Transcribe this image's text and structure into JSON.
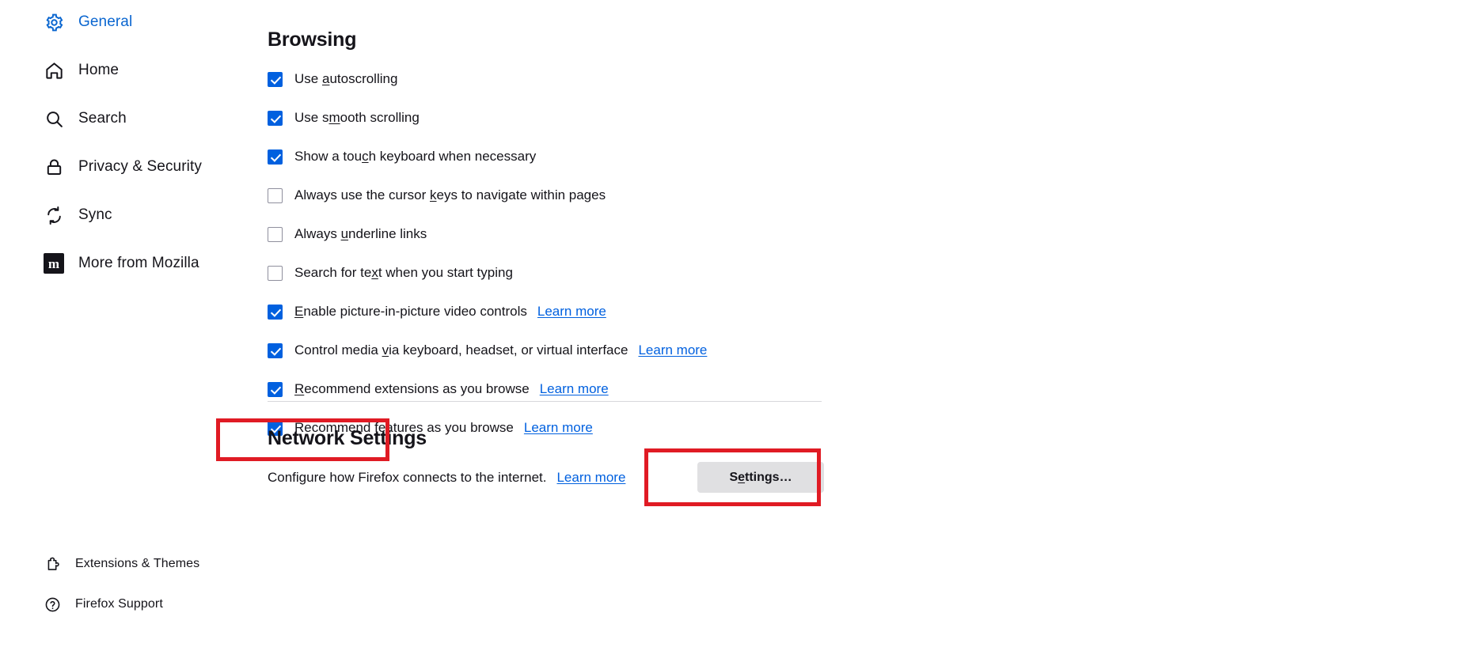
{
  "sidebar": {
    "items": [
      {
        "id": "general",
        "label": "General",
        "icon": "gear-icon",
        "active": true
      },
      {
        "id": "home",
        "label": "Home",
        "icon": "home-icon",
        "active": false
      },
      {
        "id": "search",
        "label": "Search",
        "icon": "search-icon",
        "active": false
      },
      {
        "id": "privacy",
        "label": "Privacy & Security",
        "icon": "lock-icon",
        "active": false
      },
      {
        "id": "sync",
        "label": "Sync",
        "icon": "sync-icon",
        "active": false
      },
      {
        "id": "mozilla",
        "label": "More from Mozilla",
        "icon": "mozilla-m-icon",
        "active": false,
        "badge_letter": "m"
      }
    ],
    "bottom_items": [
      {
        "id": "extensions",
        "label": "Extensions & Themes",
        "icon": "puzzle-piece-icon"
      },
      {
        "id": "support",
        "label": "Firefox Support",
        "icon": "question-circle-icon"
      }
    ]
  },
  "browsing": {
    "title": "Browsing",
    "options": [
      {
        "id": "autoscrolling",
        "checked": true,
        "pre": "Use ",
        "key": "a",
        "post": "utoscrolling",
        "learn_more": null
      },
      {
        "id": "smooth-scrolling",
        "checked": true,
        "pre": "Use s",
        "key": "m",
        "post": "ooth scrolling",
        "learn_more": null
      },
      {
        "id": "touch-keyboard",
        "checked": true,
        "pre": "Show a tou",
        "key": "c",
        "post": "h keyboard when necessary",
        "learn_more": null
      },
      {
        "id": "cursor-keys",
        "checked": false,
        "pre": "Always use the cursor ",
        "key": "k",
        "post": "eys to navigate within pages",
        "learn_more": null
      },
      {
        "id": "underline-links",
        "checked": false,
        "pre": "Always ",
        "key": "u",
        "post": "nderline links",
        "learn_more": null
      },
      {
        "id": "find-as-you-type",
        "checked": false,
        "pre": "Search for te",
        "key": "x",
        "post": "t when you start typing",
        "learn_more": null
      },
      {
        "id": "picture-in-picture",
        "checked": true,
        "pre": "",
        "key": "E",
        "post": "nable picture-in-picture video controls",
        "learn_more": "Learn more"
      },
      {
        "id": "media-control",
        "checked": true,
        "pre": "Control media ",
        "key": "v",
        "post": "ia keyboard, headset, or virtual interface",
        "learn_more": "Learn more"
      },
      {
        "id": "recommend-extensions",
        "checked": true,
        "pre": "",
        "key": "R",
        "post": "ecommend extensions as you browse",
        "learn_more": "Learn more"
      },
      {
        "id": "recommend-features",
        "checked": true,
        "pre": "Recommend ",
        "key": "f",
        "post": "eatures as you browse",
        "learn_more": "Learn more"
      }
    ]
  },
  "network": {
    "title": "Network Settings",
    "description": "Configure how Firefox connects to the internet.",
    "learn_more": "Learn more",
    "settings_button": {
      "pre": "S",
      "key": "e",
      "post": "ttings…"
    }
  },
  "annotations": {
    "highlight_color": "#e01b24",
    "boxes": [
      {
        "id": "network-settings-heading"
      },
      {
        "id": "settings-button"
      }
    ]
  }
}
